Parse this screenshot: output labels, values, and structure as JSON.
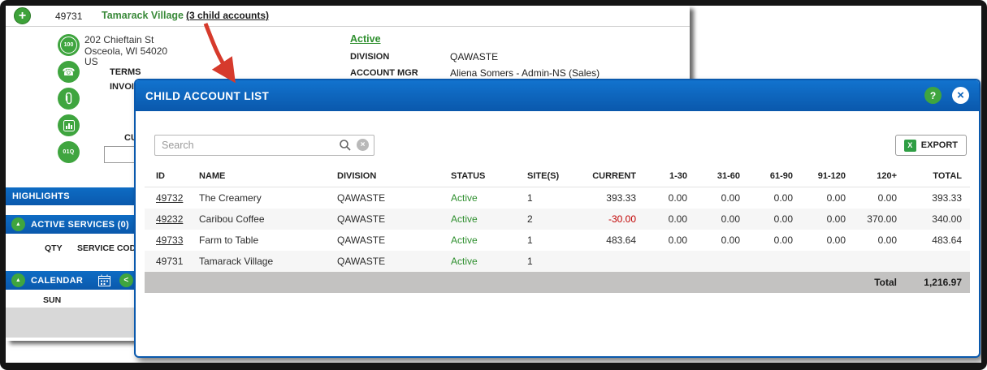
{
  "icons": {
    "plus": "+",
    "badge_100": "100",
    "phone": "☎",
    "code": "01Q",
    "chevron_up": "▲",
    "chevron_left": "<",
    "help": "?",
    "close": "×",
    "clear": "×",
    "excel": "X"
  },
  "header": {
    "account_id": "49731",
    "account_name": "Tamarack Village",
    "child_accounts_link": "(3 child accounts)"
  },
  "account": {
    "address_line1": "202 Chieftain St",
    "address_line2": "Osceola, WI 54020",
    "address_line3": "US",
    "terms_label": "TERMS",
    "invoice_label": "INVOICE",
    "cu_label": "CU",
    "status_link": "Active",
    "division_label": "DIVISION",
    "division_value": "QAWASTE",
    "account_mgr_label": "ACCOUNT MGR",
    "account_mgr_value": "Aliena Somers - Admin-NS (Sales)"
  },
  "sections": {
    "highlights_label": "HIGHLIGHTS",
    "active_services_label": "ACTIVE SERVICES (0)",
    "qty_header": "QTY",
    "service_code_header": "SERVICE CODE",
    "calendar_label": "CALENDAR",
    "sun_header": "SUN"
  },
  "modal": {
    "title": "CHILD ACCOUNT LIST",
    "search_placeholder": "Search",
    "export_label": "EXPORT",
    "table": {
      "headers": [
        "ID",
        "NAME",
        "DIVISION",
        "STATUS",
        "SITE(S)",
        "CURRENT",
        "1-30",
        "31-60",
        "61-90",
        "91-120",
        "120+",
        "TOTAL"
      ],
      "rows": [
        {
          "id": "49732",
          "name": "The Creamery",
          "division": "QAWASTE",
          "status": "Active",
          "sites": "1",
          "current": "393.33",
          "a1_30": "0.00",
          "a31_60": "0.00",
          "a61_90": "0.00",
          "a91_120": "0.00",
          "a120": "0.00",
          "total": "393.33"
        },
        {
          "id": "49232",
          "name": "Caribou Coffee",
          "division": "QAWASTE",
          "status": "Active",
          "sites": "2",
          "current": "-30.00",
          "a1_30": "0.00",
          "a31_60": "0.00",
          "a61_90": "0.00",
          "a91_120": "0.00",
          "a120": "370.00",
          "total": "340.00"
        },
        {
          "id": "49733",
          "name": "Farm to Table",
          "division": "QAWASTE",
          "status": "Active",
          "sites": "1",
          "current": "483.64",
          "a1_30": "0.00",
          "a31_60": "0.00",
          "a61_90": "0.00",
          "a91_120": "0.00",
          "a120": "0.00",
          "total": "483.64"
        },
        {
          "id": "49731",
          "name": "Tamarack Village",
          "division": "QAWASTE",
          "status": "Active",
          "sites": "1",
          "current": "",
          "a1_30": "",
          "a31_60": "",
          "a61_90": "",
          "a91_120": "",
          "a120": "",
          "total": ""
        }
      ],
      "total_label": "Total",
      "total_value": "1,216.97"
    }
  },
  "colors": {
    "titlebar_blue": "#0b62ba",
    "section_bar_blue": "#0b62ba",
    "icon_green": "#3fa53f",
    "status_green": "#2e8f2e",
    "account_name_green": "#3a8a3a",
    "negative_red": "#c00000",
    "arrow_red": "#d63a2c",
    "total_row_gray": "#c3c2c1"
  }
}
